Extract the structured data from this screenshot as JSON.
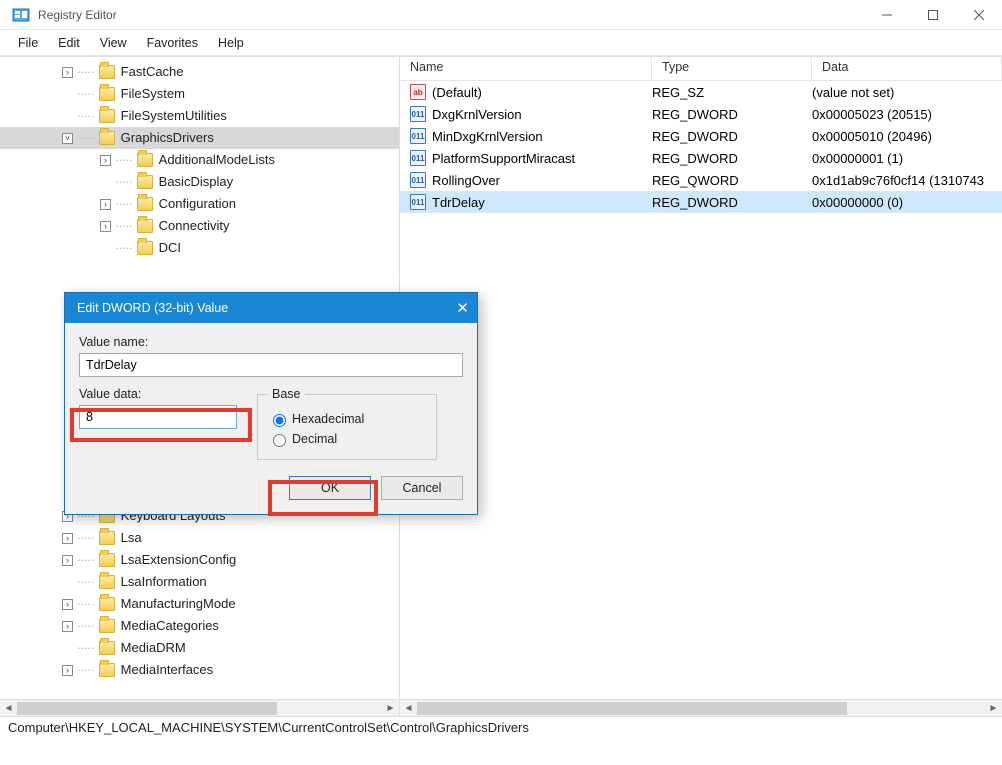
{
  "window": {
    "title": "Registry Editor"
  },
  "menu": {
    "file": "File",
    "edit": "Edit",
    "view": "View",
    "fav": "Favorites",
    "help": "Help"
  },
  "tree": {
    "top": [
      {
        "label": "FastCache",
        "toggle": ">",
        "lv": 1
      },
      {
        "label": "FileSystem",
        "toggle": "",
        "lv": 1
      },
      {
        "label": "FileSystemUtilities",
        "toggle": "",
        "lv": 1
      },
      {
        "label": "GraphicsDrivers",
        "toggle": "v",
        "lv": 1,
        "sel": true
      },
      {
        "label": "AdditionalModeLists",
        "toggle": ">",
        "lv": 2
      },
      {
        "label": "BasicDisplay",
        "toggle": "",
        "lv": 2
      },
      {
        "label": "Configuration",
        "toggle": ">",
        "lv": 2
      },
      {
        "label": "Connectivity",
        "toggle": ">",
        "lv": 2
      },
      {
        "label": "DCI",
        "toggle": "",
        "lv": 2
      }
    ],
    "bottom": [
      {
        "label": "Keyboard Layouts",
        "toggle": ">",
        "lv": 1
      },
      {
        "label": "Lsa",
        "toggle": ">",
        "lv": 1
      },
      {
        "label": "LsaExtensionConfig",
        "toggle": ">",
        "lv": 1
      },
      {
        "label": "LsaInformation",
        "toggle": "",
        "lv": 1
      },
      {
        "label": "ManufacturingMode",
        "toggle": ">",
        "lv": 1
      },
      {
        "label": "MediaCategories",
        "toggle": ">",
        "lv": 1
      },
      {
        "label": "MediaDRM",
        "toggle": "",
        "lv": 1
      },
      {
        "label": "MediaInterfaces",
        "toggle": ">",
        "lv": 1
      }
    ]
  },
  "list": {
    "headers": {
      "name": "Name",
      "type": "Type",
      "data": "Data"
    },
    "rows": [
      {
        "icon": "str",
        "name": "(Default)",
        "type": "REG_SZ",
        "data": "(value not set)"
      },
      {
        "icon": "bin",
        "name": "DxgKrnlVersion",
        "type": "REG_DWORD",
        "data": "0x00005023 (20515)"
      },
      {
        "icon": "bin",
        "name": "MinDxgKrnlVersion",
        "type": "REG_DWORD",
        "data": "0x00005010 (20496)"
      },
      {
        "icon": "bin",
        "name": "PlatformSupportMiracast",
        "type": "REG_DWORD",
        "data": "0x00000001 (1)"
      },
      {
        "icon": "bin",
        "name": "RollingOver",
        "type": "REG_QWORD",
        "data": "0x1d1ab9c76f0cf14 (1310743"
      },
      {
        "icon": "bin",
        "name": "TdrDelay",
        "type": "REG_DWORD",
        "data": "0x00000000 (0)",
        "sel": true
      }
    ]
  },
  "dialog": {
    "title": "Edit DWORD (32-bit) Value",
    "valueNameLabel": "Value name:",
    "valueName": "TdrDelay",
    "valueDataLabel": "Value data:",
    "valueData": "8",
    "baseLegend": "Base",
    "hexLabel": "Hexadecimal",
    "decLabel": "Decimal",
    "ok": "OK",
    "cancel": "Cancel"
  },
  "status": "Computer\\HKEY_LOCAL_MACHINE\\SYSTEM\\CurrentControlSet\\Control\\GraphicsDrivers"
}
